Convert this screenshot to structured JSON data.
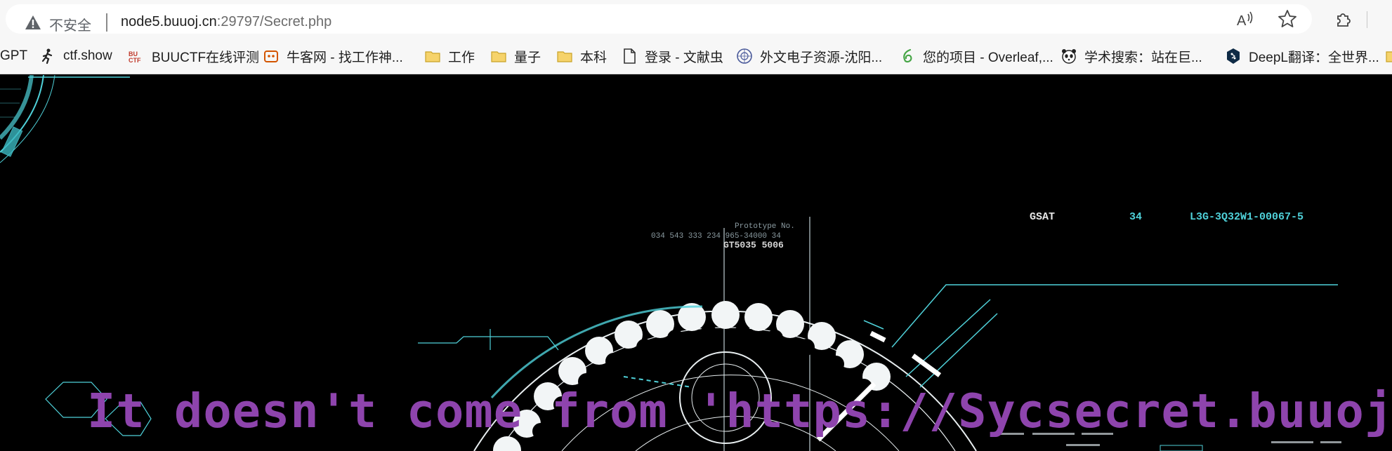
{
  "browser": {
    "security_label": "不安全",
    "url_host": "node5.buuoj.cn",
    "url_path": ":29797/Secret.php",
    "icons": [
      "warning-icon",
      "read-aloud-icon",
      "favorite-star-icon",
      "extensions-icon"
    ]
  },
  "bookmarks": [
    {
      "label": "GPT",
      "icon": "none"
    },
    {
      "label": "ctf.show",
      "icon": "runner-icon"
    },
    {
      "label": "BUUCTF在线评测",
      "icon": "buuctf-icon"
    },
    {
      "label": "牛客网 - 找工作神...",
      "icon": "nowcoder-icon"
    },
    {
      "label": "工作",
      "icon": "folder-icon"
    },
    {
      "label": "量子",
      "icon": "folder-icon"
    },
    {
      "label": "本科",
      "icon": "folder-icon"
    },
    {
      "label": "登录 - 文献虫",
      "icon": "page-icon"
    },
    {
      "label": "外文电子资源-沈阳...",
      "icon": "university-icon"
    },
    {
      "label": "您的项目 - Overleaf,...",
      "icon": "overleaf-icon"
    },
    {
      "label": "学术搜索：站在巨...",
      "icon": "panda-icon"
    },
    {
      "label": "DeepL翻译：全世界...",
      "icon": "deepl-icon"
    }
  ],
  "page": {
    "message": "It doesn't come from 'https://Sycsecret.buuoj.cn'",
    "message_color": "#8e44ad",
    "background": "#000000"
  },
  "hud": {
    "label_gsat": "GSAT",
    "label_num": "34",
    "label_id": "L3G-3Q32W1-00067-5",
    "label_proto": "Prototype No.",
    "label_serial": "034 543 333 234 965-34000 34",
    "label_code": "GT5035 5006",
    "accent": "#4fd1d9"
  }
}
